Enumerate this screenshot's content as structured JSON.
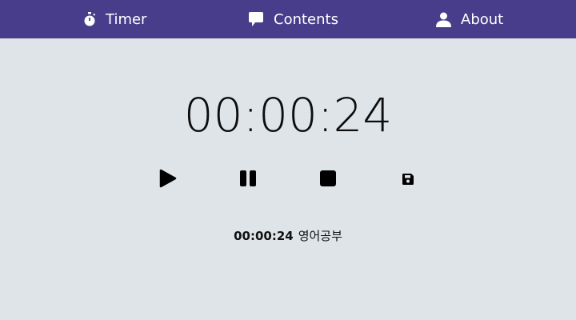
{
  "nav": {
    "items": [
      {
        "label": "Timer",
        "icon": "stopwatch-icon"
      },
      {
        "label": "Contents",
        "icon": "speech-bubble-icon"
      },
      {
        "label": "About",
        "icon": "user-icon"
      }
    ]
  },
  "timer": {
    "display": "00:00:24"
  },
  "controls": {
    "icons": [
      "play-icon",
      "pause-icon",
      "stop-icon",
      "save-icon"
    ]
  },
  "records": [
    {
      "time": "00:00:24",
      "title": "영어공부"
    }
  ],
  "colors": {
    "navbar": "#483d8b",
    "background": "#dee4e8",
    "text": "#0d0d0d"
  }
}
